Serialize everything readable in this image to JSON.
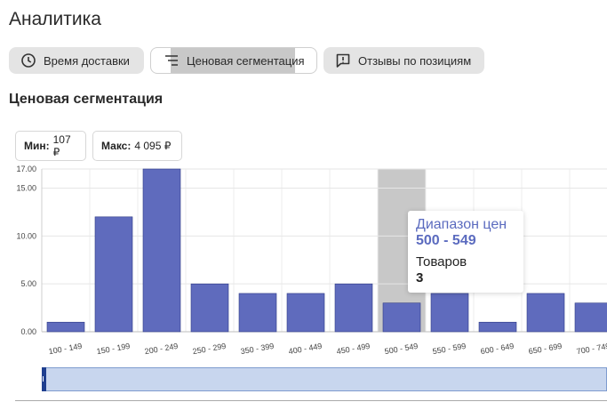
{
  "page": {
    "title": "Аналитика"
  },
  "tabs": [
    {
      "label": "Время доставки",
      "icon": "clock-icon",
      "active": false
    },
    {
      "label": "Ценовая сегментация",
      "icon": "filter-lines-icon",
      "active": true
    },
    {
      "label": "Отзывы по позициям",
      "icon": "review-bubble-icon",
      "active": false
    }
  ],
  "section": {
    "title": "Ценовая сегментация"
  },
  "stats": {
    "min": {
      "label": "Мин:",
      "value": "107 ₽"
    },
    "max": {
      "label": "Макс:",
      "value": "4 095 ₽"
    }
  },
  "chart_data": {
    "type": "bar",
    "categories": [
      "100 - 149",
      "150 - 199",
      "200 - 249",
      "250 - 299",
      "350 - 399",
      "400 - 449",
      "450 - 499",
      "500 - 549",
      "550 - 599",
      "600 - 649",
      "650 - 699",
      "700 - 749"
    ],
    "values": [
      1,
      12,
      17,
      5,
      4,
      4,
      5,
      3,
      4,
      1,
      4,
      3
    ],
    "ylim": [
      0,
      17
    ],
    "y_ticks": [
      "0.00",
      "5.00",
      "10.00",
      "15.00",
      "17.00"
    ],
    "highlighted_category": "500 - 549",
    "bar_color": "#5f6bbd",
    "highlight_color": "#c8c8c8",
    "grid": true
  },
  "tooltip": {
    "title": "Диапазон цен",
    "range": "500 - 549",
    "count_label": "Товаров",
    "count_value": "3"
  }
}
